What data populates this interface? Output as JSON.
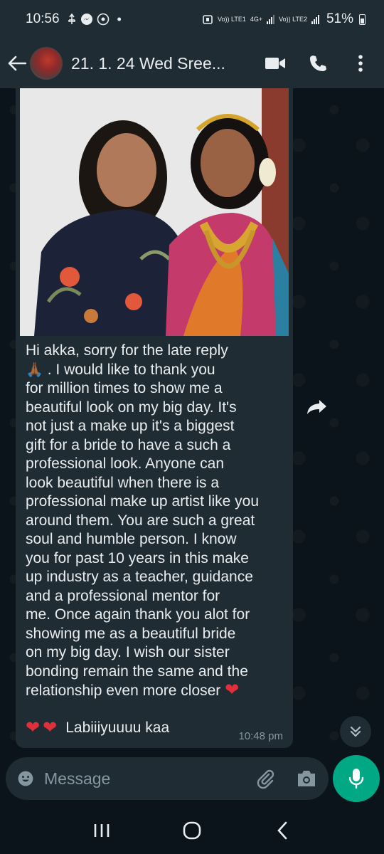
{
  "status_bar": {
    "time": "10:56",
    "sim1_label": "Vo)) LTE1",
    "net_label": "4G+",
    "sim2_label": "Vo)) LTE2",
    "battery_percent": "51%"
  },
  "header": {
    "title": "21. 1. 24 Wed Sree..."
  },
  "message": {
    "paragraph_lines": [
      "Hi akka, sorry for the late reply",
      ". I would like to thank you",
      "for million times to show me a",
      "beautiful look on my big day. It's",
      "not just a make up it's a biggest",
      "gift for a bride to have a such a",
      "professional look. Anyone can",
      "look beautiful when there is a",
      "professional make up artist like you",
      "around them. You are such a great",
      "soul and humble person. I know",
      "you for past 10 years in this make",
      "up industry as a teacher, guidance",
      "and a professional mentor for",
      "me. Once again thank you alot for",
      "showing me as a beautiful bride",
      "on my big day. I wish our sister",
      "bonding remain the same and the",
      "relationship even more closer"
    ],
    "signature": "Labiiiyuuuu kaa",
    "time": "10:48 pm"
  },
  "composer": {
    "placeholder": "Message"
  },
  "colors": {
    "bg": "#0b141a",
    "bubble": "#1f2c33",
    "accent": "#00a884",
    "text": "#e9edef",
    "muted": "#8696a0"
  }
}
